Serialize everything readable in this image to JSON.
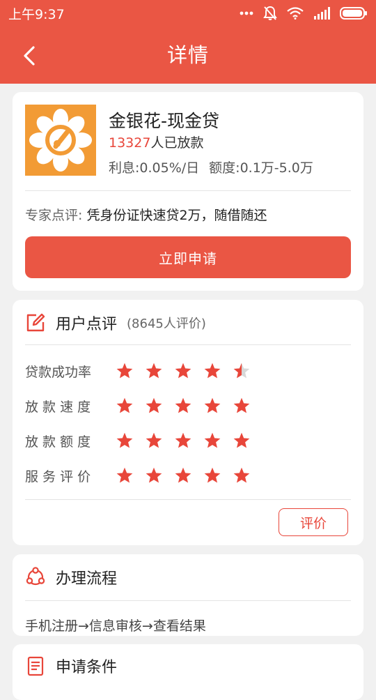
{
  "status_bar": {
    "time": "上午9:37",
    "icons": [
      "more-dots-icon",
      "mute-bell-icon",
      "wifi-icon",
      "signal-icon",
      "battery-icon"
    ]
  },
  "navbar": {
    "back_icon": "back-chevron-icon",
    "title": "详情"
  },
  "product": {
    "name": "金银花-现金贷",
    "count_number": "13327",
    "count_suffix": "人已放款",
    "interest": "利息:0.05%/日",
    "amount": "额度:0.1万-5.0万",
    "expert_label": "专家点评:",
    "expert_text": " 凭身份证快速贷2万，随借随还",
    "apply_label": "立即申请"
  },
  "reviews": {
    "title": "用户点评",
    "count_text": "(8645人评价)",
    "ratings": [
      {
        "label": "贷款成功率",
        "value": 4.5
      },
      {
        "label": "放 款 速 度",
        "value": 5
      },
      {
        "label": "放 款 额 度",
        "value": 5
      },
      {
        "label": "服 务 评 价",
        "value": 5
      }
    ],
    "rate_button": "评价"
  },
  "process": {
    "title": "办理流程",
    "steps": "手机注册→信息审核→查看结果"
  },
  "requirements": {
    "title": "申请条件"
  },
  "colors": {
    "brand_red": "#ea5644",
    "star_red": "#e8463a",
    "star_empty": "#d8d8d8",
    "logo_orange": "#f29b35"
  }
}
